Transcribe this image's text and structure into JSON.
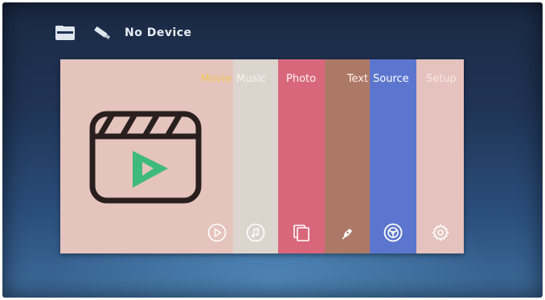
{
  "status_bar": {
    "device_text": "No Device",
    "icons": [
      "folder-icon",
      "usb-icon"
    ]
  },
  "menu": {
    "selected": "Movie",
    "items": [
      {
        "label": "Movie",
        "icon": "play-circle-icon",
        "color": "#e5c4bd"
      },
      {
        "label": "Music",
        "icon": "music-note-icon",
        "color": "#dcd5ce"
      },
      {
        "label": "Photo",
        "icon": "photo-frames-icon",
        "color": "#d9677c"
      },
      {
        "label": "Text",
        "icon": "pen-icon",
        "color": "#ad7967"
      },
      {
        "label": "Source",
        "icon": "steering-wheel-icon",
        "color": "#5c76cf"
      },
      {
        "label": "Setup",
        "icon": "gear-icon",
        "color": "#e5c2bd"
      }
    ]
  },
  "preview": {
    "icon": "clapperboard-play-icon",
    "accent_color": "#3fba7f"
  }
}
